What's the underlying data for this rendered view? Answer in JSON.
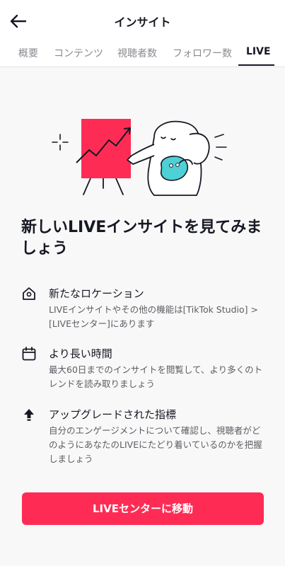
{
  "header": {
    "title": "インサイト",
    "back_icon": "arrow-left-icon"
  },
  "tabs": [
    {
      "label": "概要",
      "active": false
    },
    {
      "label": "コンテンツ",
      "active": false
    },
    {
      "label": "視聴者数",
      "active": false
    },
    {
      "label": "フォロワー数",
      "active": false
    },
    {
      "label": "LIVE",
      "active": true
    }
  ],
  "main": {
    "headline": "新しいLIVEインサイトを見てみましょう",
    "features": [
      {
        "icon": "location-home-icon",
        "title": "新たなロケーション",
        "description": "LIVEインサイトやその他の機能は[TikTok Studio] > [LIVEセンター]にあります"
      },
      {
        "icon": "calendar-icon",
        "title": "より長い時間",
        "description": "最大60日までのインサイトを閲覧して、より多くのトレンドを読み取りましょう"
      },
      {
        "icon": "upgrade-arrow-icon",
        "title": "アップグレードされた指標",
        "description": "自分のエンゲージメントについて確認し、視聴者がどのようにあなたのLIVEにたどり着いているのかを把握しましょう"
      }
    ],
    "cta_label": "LIVEセンターに移動"
  },
  "colors": {
    "accent": "#fe2c55",
    "chart_board": "#fe2c55",
    "palette_blob": "#4dd0d6"
  }
}
